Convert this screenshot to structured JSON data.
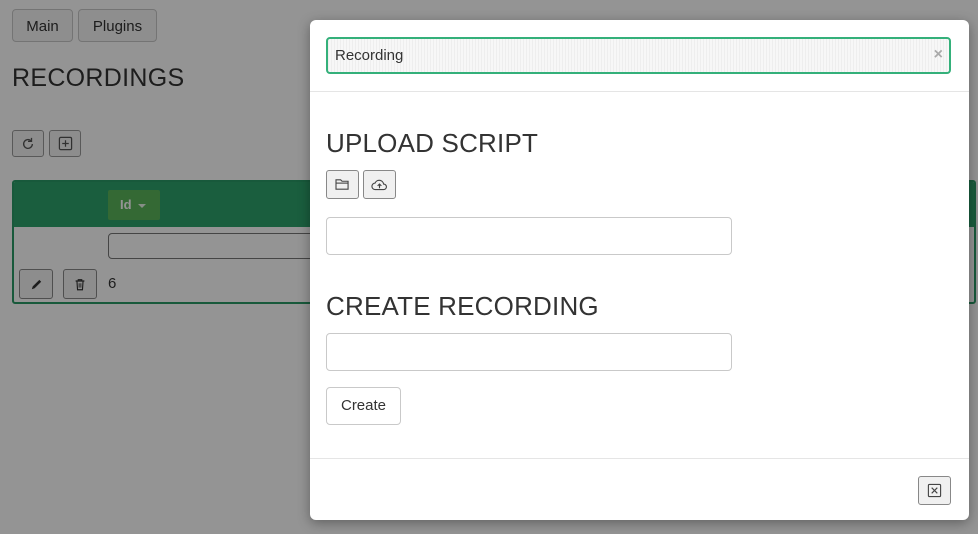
{
  "nav": {
    "main_label": "Main",
    "plugins_label": "Plugins"
  },
  "page": {
    "title": "RECORDINGS"
  },
  "toolbar": {
    "refresh_icon": "refresh-icon",
    "add_icon": "plus-square-icon"
  },
  "table": {
    "columns": [
      {
        "label": "Id",
        "sort_icon": "caret-down-icon"
      }
    ],
    "filter_value": "",
    "rows": [
      {
        "id": "6",
        "edit_icon": "pencil-icon",
        "delete_icon": "trash-icon"
      }
    ],
    "accent_color": "#2ea36c"
  },
  "modal": {
    "search": {
      "value": "Recording",
      "clear_symbol": "×"
    },
    "upload": {
      "title": "UPLOAD SCRIPT",
      "browse_icon": "folder-open-icon",
      "upload_icon": "cloud-upload-icon",
      "field_value": ""
    },
    "create": {
      "title": "CREATE RECORDING",
      "field_value": "",
      "button_label": "Create"
    },
    "footer": {
      "close_icon": "close-square-icon"
    },
    "accent_color": "#34b07a"
  }
}
